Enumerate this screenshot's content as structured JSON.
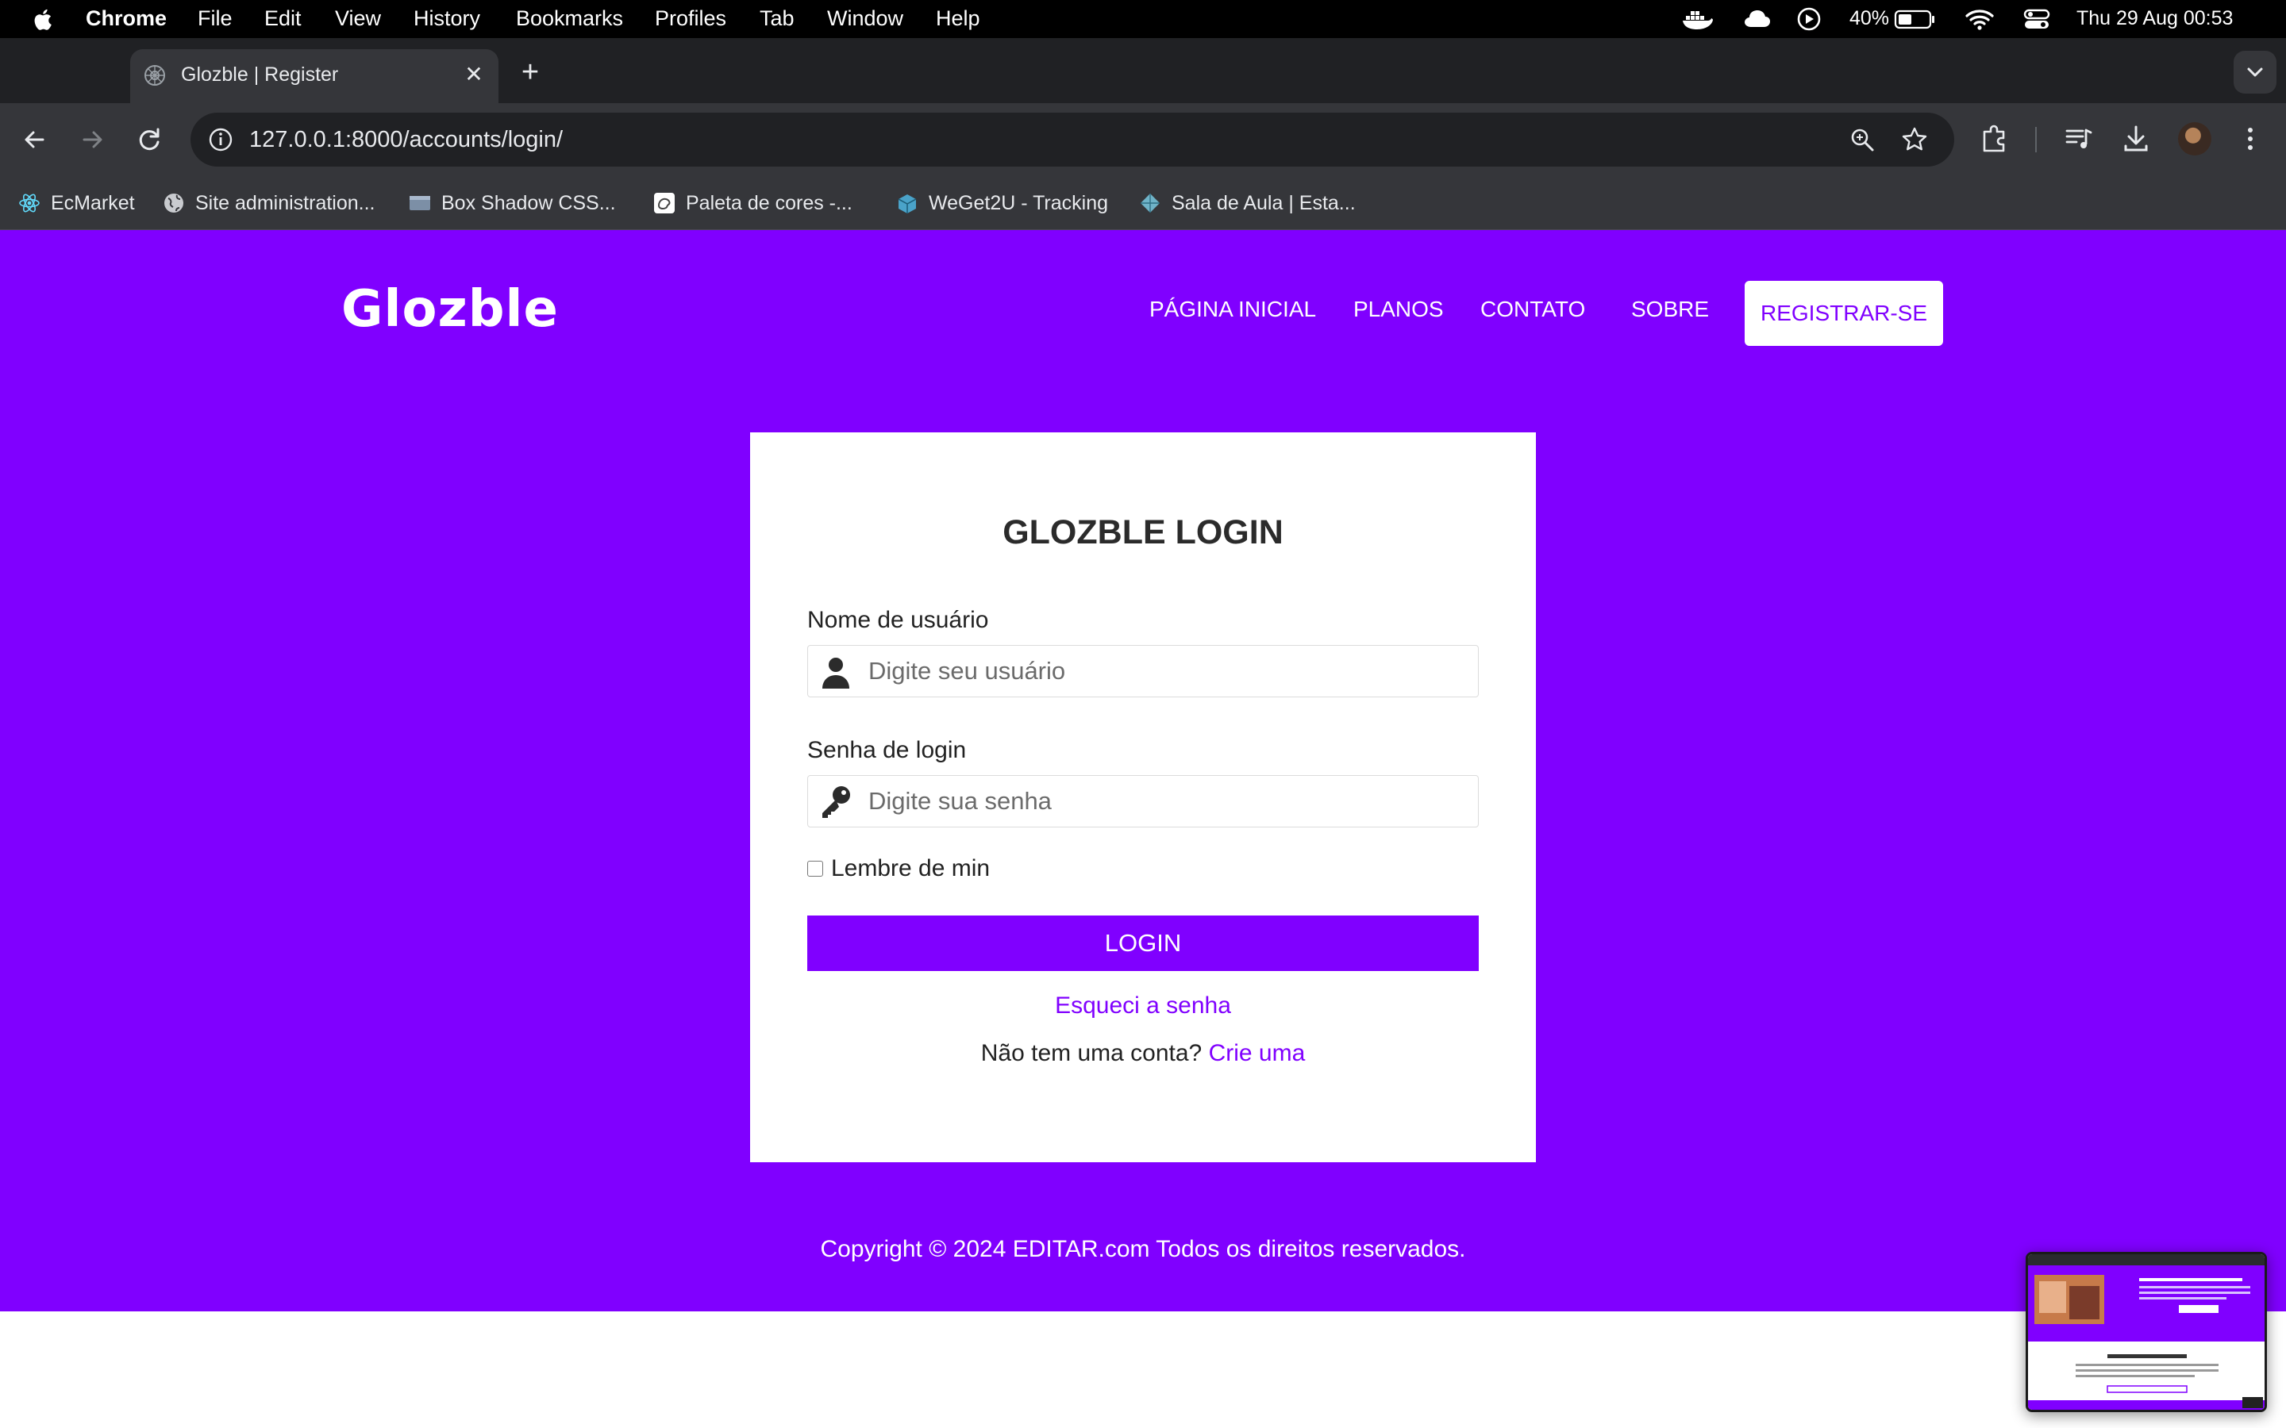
{
  "menubar": {
    "app": "Chrome",
    "items": [
      "File",
      "Edit",
      "View",
      "History",
      "Bookmarks",
      "Profiles",
      "Tab",
      "Window",
      "Help"
    ],
    "battery": "40%",
    "datetime": "Thu 29 Aug  00:53"
  },
  "tab": {
    "title": "Glozble | Register"
  },
  "omnibox": {
    "url": "127.0.0.1:8000/accounts/login/"
  },
  "bookmarks": [
    {
      "label": "EcMarket",
      "icon": "react-icon"
    },
    {
      "label": "Site administration...",
      "icon": "globe-icon"
    },
    {
      "label": "Box Shadow CSS...",
      "icon": "window-icon"
    },
    {
      "label": "Paleta de cores -...",
      "icon": "palette-icon"
    },
    {
      "label": "WeGet2U - Tracking",
      "icon": "box-icon"
    },
    {
      "label": "Sala de Aula | Esta...",
      "icon": "diamond-icon"
    }
  ],
  "site": {
    "logo": "Glozble",
    "nav": {
      "home": "PÁGINA INICIAL",
      "plans": "PLANOS",
      "contact": "CONTATO",
      "about": "SOBRE",
      "register": "REGISTRAR-SE"
    },
    "colors": {
      "brand": "#8000ff",
      "card": "#ffffff"
    }
  },
  "login": {
    "title": "GLOZBLE LOGIN",
    "username_label": "Nome de usuário",
    "username_placeholder": "Digite seu usuário",
    "password_label": "Senha de login",
    "password_placeholder": "Digite sua senha",
    "remember_label": "Lembre de min",
    "submit": "LOGIN",
    "forgot": "Esqueci a senha",
    "no_account": "Não tem uma conta?",
    "create_link": "Crie uma"
  },
  "footer": {
    "copyright": "Copyright © 2024 EDITAR.com Todos os direitos reservados."
  }
}
